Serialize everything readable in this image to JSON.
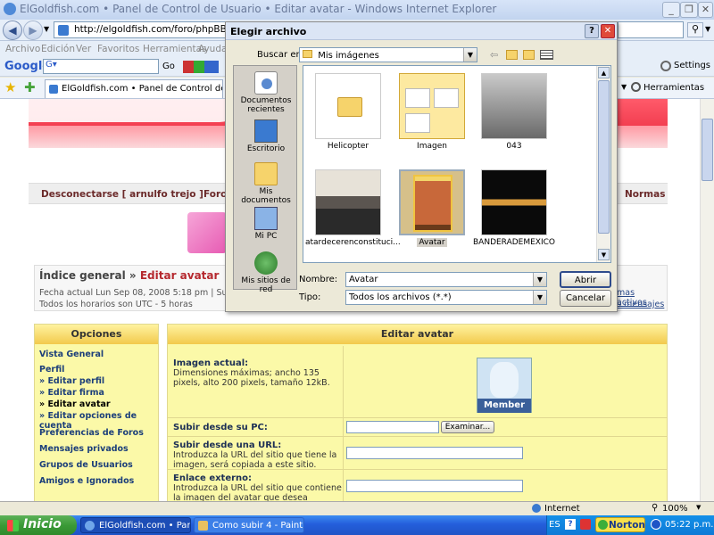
{
  "browser": {
    "title": "ElGoldfish.com • Panel de Control de Usuario • Editar avatar - Windows Internet Explorer",
    "address": "http://elgoldfish.com/foro/phpBB2/ucp.php?i",
    "menu": [
      "Archivo",
      "Edición",
      "Ver",
      "Favoritos",
      "Herramientas",
      "Ayuda"
    ],
    "google_label": "Google",
    "google_go": "Go",
    "settings": "Settings",
    "tab_label": "ElGoldfish.com • Panel de Control de Usuario • Editar avatar",
    "tools_label": "Herramientas",
    "status_zone": "Internet",
    "zoom": "100%"
  },
  "page": {
    "nav_links": {
      "logout": "Desconectarse [ arnulfo trejo ]",
      "forum": "Foro",
      "rules": "Normas"
    },
    "breadcrumb": {
      "index": "Índice general",
      "sep": "»",
      "current": "Editar avatar"
    },
    "date_line": "Fecha actual Lun Sep 08, 2008 5:18 pm | Su últ",
    "tz_line": "Todos los horarios son UTC - 5 horas",
    "right_links": [
      "mas activos",
      "s mensajes"
    ],
    "options": {
      "header": "Opciones",
      "items": [
        "Vista General",
        "Perfil",
        "» Editar perfil",
        "» Editar firma",
        "» Editar avatar",
        "» Editar opciones de cuenta",
        "Preferencias de Foros",
        "Mensajes privados",
        "Grupos de Usuarios",
        "Amigos e Ignorados"
      ]
    },
    "edit": {
      "header": "Editar avatar",
      "current_label": "Imagen actual:",
      "current_desc": "Dimensiones máximas; ancho 135 pixels, alto 200 pixels, tamaño 12kB.",
      "avatar_caption": "Member",
      "upload_pc_label": "Subir desde su PC:",
      "browse_button": "Examinar...",
      "upload_url_label": "Subir desde una URL:",
      "upload_url_desc": "Introduzca la URL del sitio que tiene la imagen, será copiada a este sitio.",
      "external_label": "Enlace externo:",
      "external_desc": "Introduzca la URL del sitio que contiene la imagen del avatar que desea enlazar."
    }
  },
  "dialog": {
    "title": "Elegir archivo",
    "look_in_label": "Buscar en:",
    "look_in_value": "Mis imágenes",
    "places": [
      "Documentos recientes",
      "Escritorio",
      "Mis documentos",
      "Mi PC",
      "Mis sitios de red"
    ],
    "files": [
      {
        "name": "Helicopter",
        "kind": "folder"
      },
      {
        "name": "Imagen",
        "kind": "folder-selected"
      },
      {
        "name": "043",
        "kind": "photo-snow"
      },
      {
        "name": "atardecerenconstituci...",
        "kind": "photo-road"
      },
      {
        "name": "Avatar",
        "kind": "photo-magazine"
      },
      {
        "name": "BANDERADEMEXICO",
        "kind": "photo-night"
      }
    ],
    "filename_label": "Nombre:",
    "filename_value": "Avatar",
    "filetype_label": "Tipo:",
    "filetype_value": "Todos los archivos (*.*)",
    "open_button": "Abrir",
    "cancel_button": "Cancelar"
  },
  "taskbar": {
    "start": "Inicio",
    "tasks": [
      "ElGoldfish.com • Panel...",
      "Como subir 4 - Paint"
    ],
    "lang": "ES",
    "norton": "Norton",
    "clock": "05:22 p.m."
  }
}
